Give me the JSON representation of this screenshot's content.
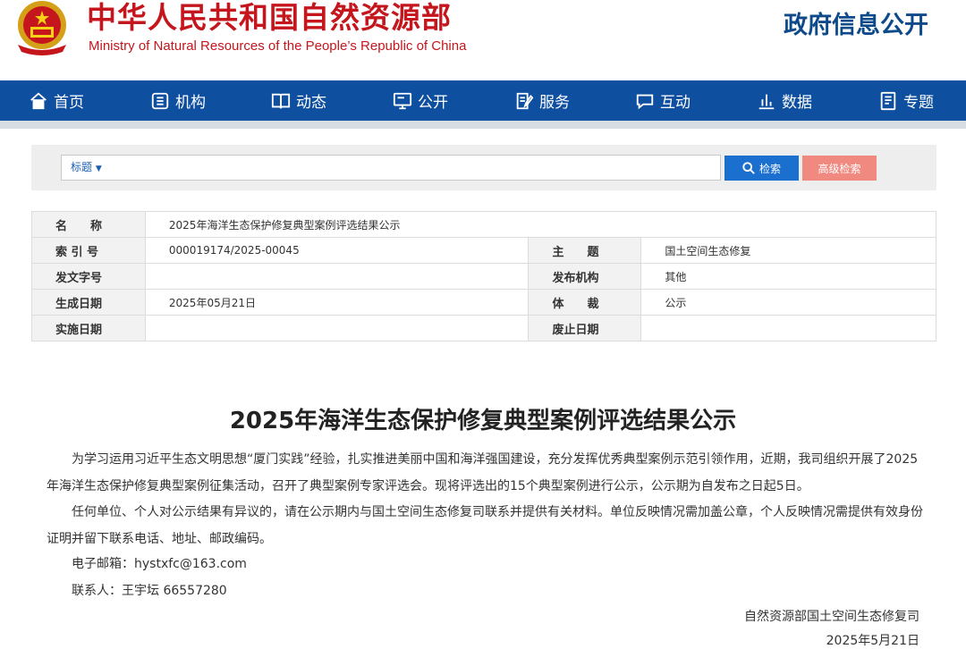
{
  "header": {
    "title_cn": "中华人民共和国自然资源部",
    "title_en": "Ministry of Natural Resources of the People’s Republic of China",
    "section": "政府信息公开"
  },
  "nav": {
    "items": [
      {
        "label": "首页",
        "icon": "home-icon"
      },
      {
        "label": "机构",
        "icon": "org-icon"
      },
      {
        "label": "动态",
        "icon": "book-icon"
      },
      {
        "label": "公开",
        "icon": "monitor-icon"
      },
      {
        "label": "服务",
        "icon": "edit-icon"
      },
      {
        "label": "互动",
        "icon": "chat-icon"
      },
      {
        "label": "数据",
        "icon": "chart-icon"
      },
      {
        "label": "专题",
        "icon": "document-icon"
      }
    ]
  },
  "search": {
    "select_label": "标题",
    "input_value": "",
    "search_button": "检索",
    "advanced_button": "高级检索"
  },
  "info": {
    "name_label": "名　　称",
    "name_value": "2025年海洋生态保护修复典型案例评选结果公示",
    "index_label": "索 引 号",
    "index_value": "000019174/2025-00045",
    "topic_label": "主　　题",
    "topic_value": "国土空间生态修复",
    "docno_label": "发文字号",
    "docno_value": "",
    "publisher_label": "发布机构",
    "publisher_value": "其他",
    "created_label": "生成日期",
    "created_value": "2025年05月21日",
    "genre_label": "体　　裁",
    "genre_value": "公示",
    "effective_label": "实施日期",
    "effective_value": "",
    "expire_label": "废止日期",
    "expire_value": ""
  },
  "article": {
    "title": "2025年海洋生态保护修复典型案例评选结果公示",
    "para1": "为学习运用习近平生态文明思想“厦门实践”经验，扎实推进美丽中国和海洋强国建设，充分发挥优秀典型案例示范引领作用，近期，我司组织开展了2025年海洋生态保护修复典型案例征集活动，召开了典型案例专家评选会。现将评选出的15个典型案例进行公示，公示期为自发布之日起5日。",
    "para2": "任何单位、个人对公示结果有异议的，请在公示期内与国土空间生态修复司联系并提供有关材料。单位反映情况需加盖公章，个人反映情况需提供有效身份证明并留下联系电话、地址、邮政编码。",
    "email": "电子邮箱：hystxfc@163.com",
    "contact": "联系人：王宇坛 66557280",
    "signature": "自然资源部国土空间生态修复司",
    "date": "2025年5月21日"
  },
  "colors": {
    "brand_red": "#c4161c",
    "nav_blue": "#0f4fa0",
    "search_blue": "#1a6fcf",
    "advanced_pink": "#f08a80"
  }
}
